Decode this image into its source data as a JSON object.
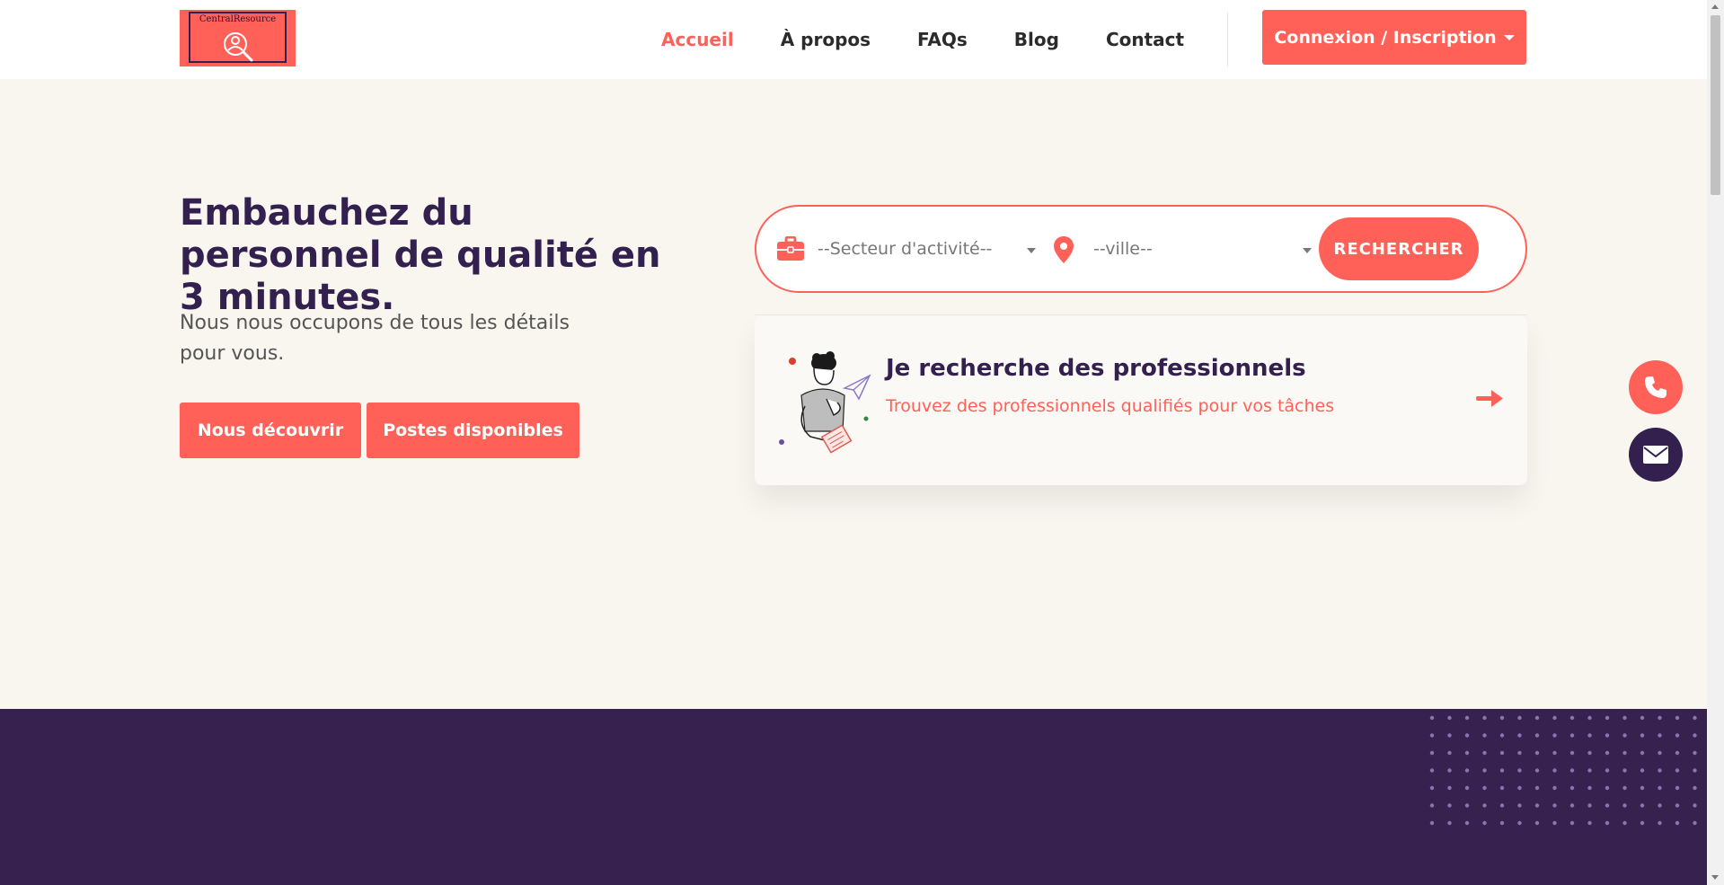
{
  "header": {
    "logo_text": "CentralResource",
    "nav": [
      {
        "label": "Accueil",
        "active": true
      },
      {
        "label": "À propos",
        "active": false
      },
      {
        "label": "FAQs",
        "active": false
      },
      {
        "label": "Blog",
        "active": false
      },
      {
        "label": "Contact",
        "active": false
      }
    ],
    "login_label": "Connexion / Inscription"
  },
  "hero": {
    "title": "Embauchez du personnel de qualité en 3 minutes.",
    "subtitle": "Nous nous occupons de tous les détails pour vous.",
    "buttons": {
      "discover": "Nous découvrir",
      "jobs": "Postes disponibles"
    }
  },
  "search": {
    "sector_placeholder": "--Secteur d'activité--",
    "city_placeholder": "--ville--",
    "button_label": "RECHERCHER"
  },
  "card": {
    "title": "Je recherche des professionnels",
    "description": "Trouvez des professionnels qualifiés pour vos tâches"
  },
  "colors": {
    "accent": "#ff6159",
    "primary_dark": "#33204f",
    "background": "#f9f6f0",
    "band": "#37214f"
  },
  "icons": {
    "logo": "search-person-icon",
    "sector": "briefcase-icon",
    "city": "map-pin-icon",
    "card_arrow": "arrow-right-icon",
    "phone": "phone-icon",
    "mail": "envelope-icon"
  }
}
